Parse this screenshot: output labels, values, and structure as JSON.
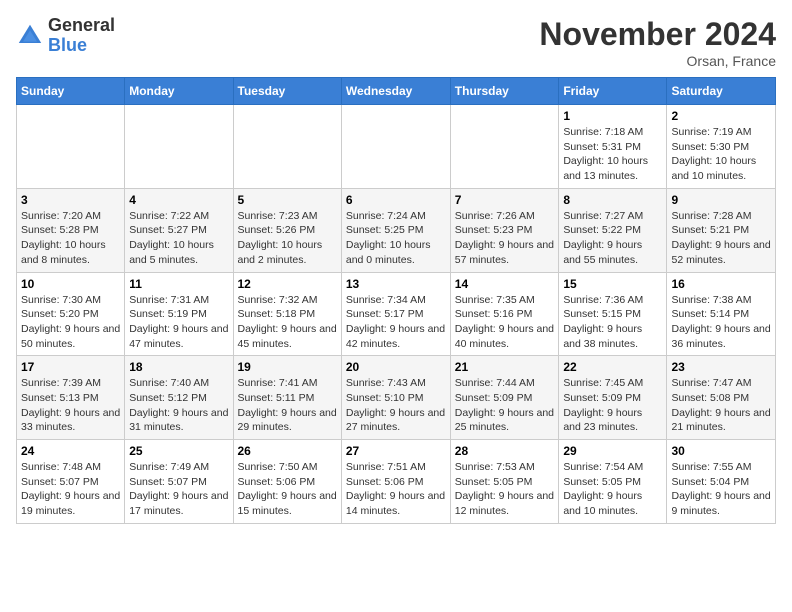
{
  "header": {
    "logo_general": "General",
    "logo_blue": "Blue",
    "month_title": "November 2024",
    "location": "Orsan, France"
  },
  "weekdays": [
    "Sunday",
    "Monday",
    "Tuesday",
    "Wednesday",
    "Thursday",
    "Friday",
    "Saturday"
  ],
  "weeks": [
    [
      {
        "day": "",
        "info": ""
      },
      {
        "day": "",
        "info": ""
      },
      {
        "day": "",
        "info": ""
      },
      {
        "day": "",
        "info": ""
      },
      {
        "day": "",
        "info": ""
      },
      {
        "day": "1",
        "info": "Sunrise: 7:18 AM\nSunset: 5:31 PM\nDaylight: 10 hours and 13 minutes."
      },
      {
        "day": "2",
        "info": "Sunrise: 7:19 AM\nSunset: 5:30 PM\nDaylight: 10 hours and 10 minutes."
      }
    ],
    [
      {
        "day": "3",
        "info": "Sunrise: 7:20 AM\nSunset: 5:28 PM\nDaylight: 10 hours and 8 minutes."
      },
      {
        "day": "4",
        "info": "Sunrise: 7:22 AM\nSunset: 5:27 PM\nDaylight: 10 hours and 5 minutes."
      },
      {
        "day": "5",
        "info": "Sunrise: 7:23 AM\nSunset: 5:26 PM\nDaylight: 10 hours and 2 minutes."
      },
      {
        "day": "6",
        "info": "Sunrise: 7:24 AM\nSunset: 5:25 PM\nDaylight: 10 hours and 0 minutes."
      },
      {
        "day": "7",
        "info": "Sunrise: 7:26 AM\nSunset: 5:23 PM\nDaylight: 9 hours and 57 minutes."
      },
      {
        "day": "8",
        "info": "Sunrise: 7:27 AM\nSunset: 5:22 PM\nDaylight: 9 hours and 55 minutes."
      },
      {
        "day": "9",
        "info": "Sunrise: 7:28 AM\nSunset: 5:21 PM\nDaylight: 9 hours and 52 minutes."
      }
    ],
    [
      {
        "day": "10",
        "info": "Sunrise: 7:30 AM\nSunset: 5:20 PM\nDaylight: 9 hours and 50 minutes."
      },
      {
        "day": "11",
        "info": "Sunrise: 7:31 AM\nSunset: 5:19 PM\nDaylight: 9 hours and 47 minutes."
      },
      {
        "day": "12",
        "info": "Sunrise: 7:32 AM\nSunset: 5:18 PM\nDaylight: 9 hours and 45 minutes."
      },
      {
        "day": "13",
        "info": "Sunrise: 7:34 AM\nSunset: 5:17 PM\nDaylight: 9 hours and 42 minutes."
      },
      {
        "day": "14",
        "info": "Sunrise: 7:35 AM\nSunset: 5:16 PM\nDaylight: 9 hours and 40 minutes."
      },
      {
        "day": "15",
        "info": "Sunrise: 7:36 AM\nSunset: 5:15 PM\nDaylight: 9 hours and 38 minutes."
      },
      {
        "day": "16",
        "info": "Sunrise: 7:38 AM\nSunset: 5:14 PM\nDaylight: 9 hours and 36 minutes."
      }
    ],
    [
      {
        "day": "17",
        "info": "Sunrise: 7:39 AM\nSunset: 5:13 PM\nDaylight: 9 hours and 33 minutes."
      },
      {
        "day": "18",
        "info": "Sunrise: 7:40 AM\nSunset: 5:12 PM\nDaylight: 9 hours and 31 minutes."
      },
      {
        "day": "19",
        "info": "Sunrise: 7:41 AM\nSunset: 5:11 PM\nDaylight: 9 hours and 29 minutes."
      },
      {
        "day": "20",
        "info": "Sunrise: 7:43 AM\nSunset: 5:10 PM\nDaylight: 9 hours and 27 minutes."
      },
      {
        "day": "21",
        "info": "Sunrise: 7:44 AM\nSunset: 5:09 PM\nDaylight: 9 hours and 25 minutes."
      },
      {
        "day": "22",
        "info": "Sunrise: 7:45 AM\nSunset: 5:09 PM\nDaylight: 9 hours and 23 minutes."
      },
      {
        "day": "23",
        "info": "Sunrise: 7:47 AM\nSunset: 5:08 PM\nDaylight: 9 hours and 21 minutes."
      }
    ],
    [
      {
        "day": "24",
        "info": "Sunrise: 7:48 AM\nSunset: 5:07 PM\nDaylight: 9 hours and 19 minutes."
      },
      {
        "day": "25",
        "info": "Sunrise: 7:49 AM\nSunset: 5:07 PM\nDaylight: 9 hours and 17 minutes."
      },
      {
        "day": "26",
        "info": "Sunrise: 7:50 AM\nSunset: 5:06 PM\nDaylight: 9 hours and 15 minutes."
      },
      {
        "day": "27",
        "info": "Sunrise: 7:51 AM\nSunset: 5:06 PM\nDaylight: 9 hours and 14 minutes."
      },
      {
        "day": "28",
        "info": "Sunrise: 7:53 AM\nSunset: 5:05 PM\nDaylight: 9 hours and 12 minutes."
      },
      {
        "day": "29",
        "info": "Sunrise: 7:54 AM\nSunset: 5:05 PM\nDaylight: 9 hours and 10 minutes."
      },
      {
        "day": "30",
        "info": "Sunrise: 7:55 AM\nSunset: 5:04 PM\nDaylight: 9 hours and 9 minutes."
      }
    ]
  ]
}
